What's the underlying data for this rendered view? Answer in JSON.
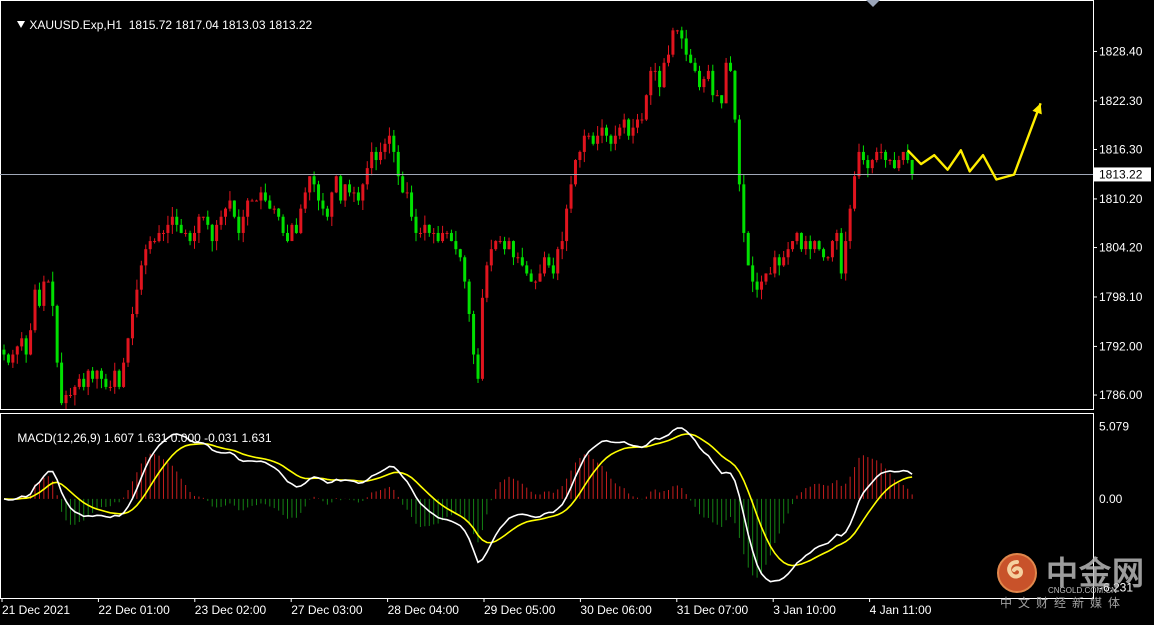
{
  "chart_header": {
    "symbol_timeframe": "XAUUSD.Exp,H1",
    "ohlc": "1815.72 1817.04 1813.03 1813.22"
  },
  "macd_header": {
    "label": "MACD(12,26,9) 1.607 1.631 0.000 -0.031 1.631"
  },
  "colors": {
    "background": "#000000",
    "bull": "#e0141e",
    "bear": "#00e000",
    "frame": "#ffffff",
    "price_line": "#a0a8b8",
    "macd_line": "#ffffff",
    "signal_line": "#ffff00",
    "hist_up": "#c81e1e",
    "hist_down": "#148214",
    "arrow": "#ffee00"
  },
  "watermark": {
    "brand_cn": "中金网",
    "brand_en": "CNGOLD.COM.CN",
    "slogan_cn": "中文财经新媒体"
  },
  "chart_data": {
    "type": "candlestick",
    "symbol": "XAUUSD.Exp",
    "timeframe": "H1",
    "current_price": "1813.22",
    "y_ticks": [
      "1828.40",
      "1822.30",
      "1816.30",
      "1810.20",
      "1804.20",
      "1798.10",
      "1792.00",
      "1786.00"
    ],
    "ylim": [
      1784.4,
      1834.5
    ],
    "x_ticks": [
      "21 Dec 2021",
      "22 Dec 01:00",
      "23 Dec 02:00",
      "27 Dec 03:00",
      "28 Dec 04:00",
      "29 Dec 05:00",
      "30 Dec 06:00",
      "31 Dec 07:00",
      "3 Jan 10:00",
      "4 Jan 11:00"
    ],
    "closes": [
      1791,
      1790,
      1791,
      1792,
      1793,
      1791,
      1794,
      1799,
      1797,
      1800,
      1800,
      1797,
      1790,
      1785,
      1786,
      1786,
      1787,
      1788,
      1787,
      1789,
      1788,
      1789,
      1788,
      1787,
      1787,
      1789,
      1787,
      1790,
      1793,
      1796,
      1799,
      1802,
      1804,
      1805,
      1805,
      1806,
      1806,
      1807,
      1808,
      1807,
      1806,
      1806,
      1805,
      1806,
      1808,
      1808,
      1807,
      1805,
      1807,
      1808,
      1809,
      1810,
      1808,
      1806,
      1808,
      1810,
      1810,
      1810,
      1811,
      1810,
      1809,
      1809,
      1808,
      1806,
      1805,
      1807,
      1806,
      1809,
      1811,
      1813,
      1812,
      1810,
      1809,
      1808,
      1811,
      1813,
      1810,
      1812,
      1811,
      1811,
      1810,
      1812,
      1814,
      1816,
      1815,
      1816,
      1817,
      1818,
      1816,
      1813,
      1811,
      1811,
      1808,
      1806,
      1806,
      1807,
      1806,
      1806,
      1805,
      1806,
      1806,
      1805,
      1804,
      1803,
      1800,
      1796,
      1791,
      1788,
      1798,
      1802,
      1804,
      1805,
      1805,
      1804,
      1805,
      1803,
      1803,
      1802,
      1801,
      1800,
      1800,
      1801,
      1803,
      1802,
      1801,
      1804,
      1805,
      1809,
      1812,
      1815,
      1816,
      1818,
      1818,
      1817,
      1818,
      1819,
      1818,
      1817,
      1818,
      1819,
      1820,
      1818,
      1819,
      1820,
      1820,
      1823,
      1826,
      1826,
      1824,
      1827,
      1828,
      1831,
      1831,
      1830,
      1828,
      1827,
      1826,
      1824,
      1825,
      1826,
      1823,
      1823,
      1822,
      1827,
      1826,
      1820,
      1812,
      1806,
      1802,
      1800,
      1799,
      1800,
      1801,
      1801,
      1803,
      1802,
      1803,
      1804,
      1805,
      1806,
      1804,
      1805,
      1804,
      1805,
      1804,
      1803,
      1803,
      1805,
      1806,
      1801,
      1805,
      1809,
      1813,
      1816,
      1815,
      1814,
      1815,
      1816,
      1816,
      1815,
      1815,
      1814,
      1815,
      1816,
      1815,
      1813.22
    ],
    "macd": {
      "y_ticks": [
        "5.079",
        "0.00",
        "-6.231"
      ],
      "ylim": [
        -6.9,
        5.9
      ],
      "params": "12,26,9",
      "values": [
        "1.607",
        "1.631",
        "0.000",
        "-0.031",
        "1.631"
      ]
    },
    "projection_path": [
      [
        -1,
        1816.2
      ],
      [
        2,
        1814.5
      ],
      [
        5,
        1815.6
      ],
      [
        8,
        1813.8
      ],
      [
        11,
        1816.2
      ],
      [
        13,
        1813.6
      ],
      [
        16,
        1815.6
      ],
      [
        19,
        1812.6
      ],
      [
        23,
        1813.2
      ],
      [
        29,
        1822.0
      ]
    ]
  }
}
